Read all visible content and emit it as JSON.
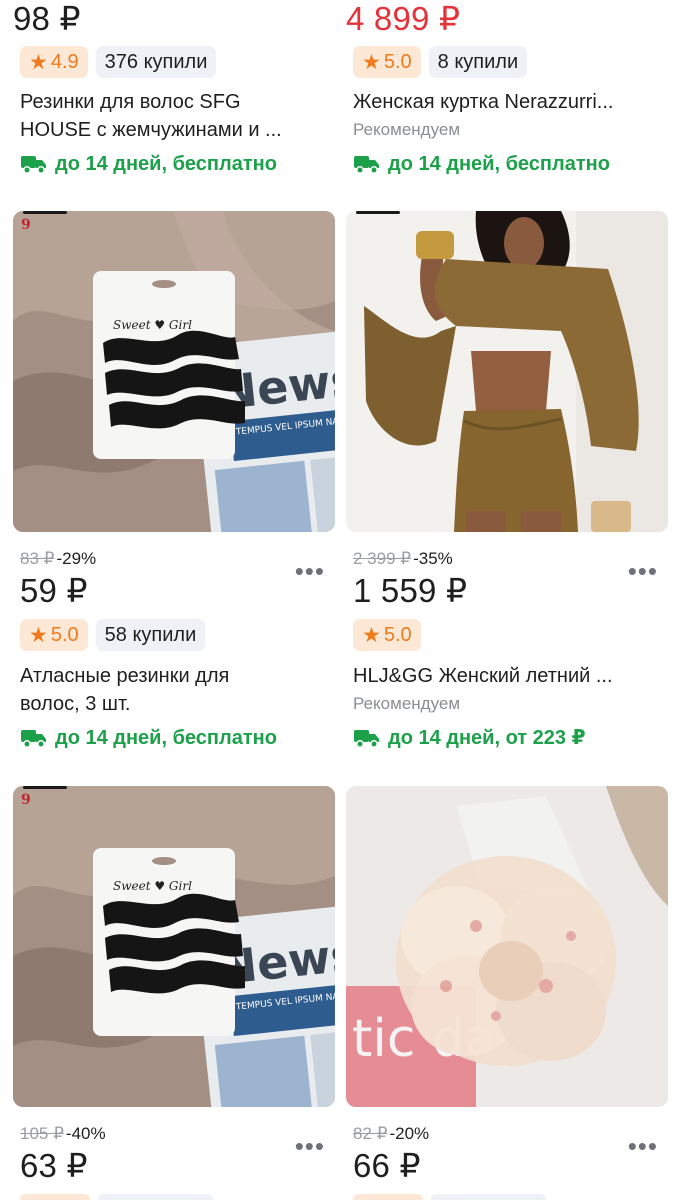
{
  "row1": {
    "left": {
      "price": "98 ₽",
      "rating": "4.9",
      "bought": "376 купили",
      "title_line1": "Резинки для волос SFG",
      "title_line2": "HOUSE с жемчужинами и ...",
      "delivery": "до 14 дней, бесплатно"
    },
    "right": {
      "price": "4 899 ₽",
      "rating": "5.0",
      "bought": "8 купили",
      "title": "Женская куртка Nerazzurri...",
      "recommend": "Рекомендуем",
      "delivery": "до 14 дней, бесплатно"
    }
  },
  "row2": {
    "left": {
      "image_badge": "9",
      "card_text": "Sweet ♥ Girl",
      "newspaper_big": "News",
      "newspaper_small": "TEMPUS VEL IPSUM NAM TELLUS",
      "old_price": "83 ₽",
      "discount": "-29%",
      "price": "59 ₽",
      "rating": "5.0",
      "bought": "58 купили",
      "title_line1": "Атласные резинки для",
      "title_line2": "волос, 3 шт.",
      "delivery": "до 14 дней, бесплатно",
      "more": "•••"
    },
    "right": {
      "old_price": "2 399 ₽",
      "discount": "-35%",
      "price": "1 559 ₽",
      "rating": "5.0",
      "title": "HLJ&GG  Женский летний ...",
      "recommend": "Рекомендуем",
      "delivery": "до 14 дней, от 223 ₽",
      "more": "•••"
    }
  },
  "row3": {
    "left": {
      "image_badge": "9",
      "card_text": "Sweet ♥ Girl",
      "newspaper_big": "News",
      "newspaper_small": "TEMPUS VEL IPSUM NAM TELLUS",
      "old_price": "105 ₽",
      "discount": "-40%",
      "price": "63 ₽",
      "more": "•••"
    },
    "right": {
      "image_text": "tic day",
      "old_price": "82 ₽",
      "discount": "-20%",
      "price": "66 ₽",
      "more": "•••"
    }
  },
  "colors": {
    "price_red": "#e5333a",
    "delivery_green": "#1ca14a",
    "rating_bg": "#fde8d6",
    "rating_fg": "#f07a1e",
    "muted": "#8a8d92"
  },
  "icons": [
    "star-icon",
    "truck-icon",
    "more-dots-icon"
  ]
}
